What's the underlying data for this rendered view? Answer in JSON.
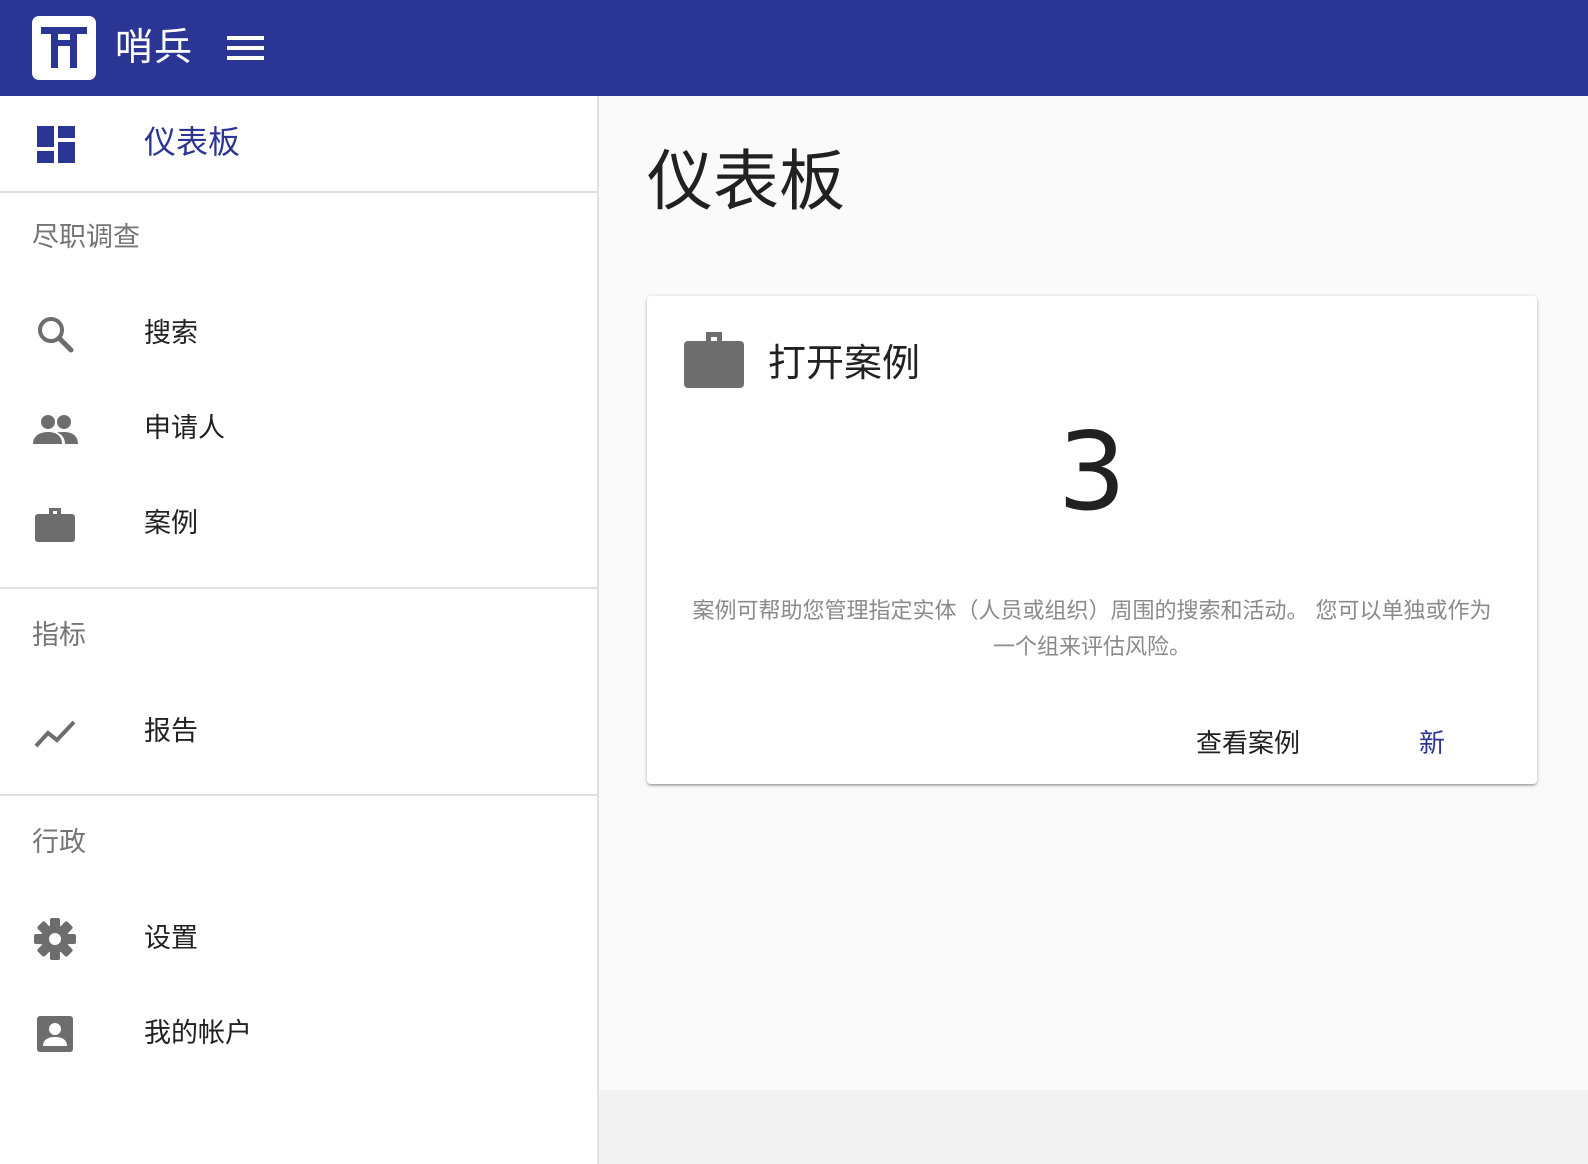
{
  "app": {
    "name": "哨兵",
    "logo_letter": "T",
    "brand_color": "#2b3593",
    "logo_icon": "logo-icon",
    "menu_icon": "hamburger-menu-icon"
  },
  "sidebar": {
    "dashboard": {
      "label": "仪表板",
      "icon": "dashboard-icon"
    },
    "sections": [
      {
        "header": "尽职调查",
        "items": [
          {
            "label": "搜索",
            "icon": "search-icon"
          },
          {
            "label": "申请人",
            "icon": "people-icon"
          },
          {
            "label": "案例",
            "icon": "briefcase-icon"
          }
        ]
      },
      {
        "header": "指标",
        "items": [
          {
            "label": "报告",
            "icon": "trending-chart-icon"
          }
        ]
      },
      {
        "header": "行政",
        "items": [
          {
            "label": "设置",
            "icon": "gear-icon"
          },
          {
            "label": "我的帐户",
            "icon": "account-box-icon"
          }
        ]
      }
    ]
  },
  "main": {
    "page_title": "仪表板",
    "card": {
      "icon": "briefcase-icon",
      "title": "打开案例",
      "count": "3",
      "description": "案例可帮助您管理指定实体（人员或组织）周围的搜索和活动。 您可以单独或作为一个组来评估风险。",
      "view_button": "查看案例",
      "new_button": "新"
    }
  },
  "colors": {
    "accent": "#2b3593",
    "icon_gray": "#6d6d6d",
    "muted_text": "#8a8a8a"
  }
}
